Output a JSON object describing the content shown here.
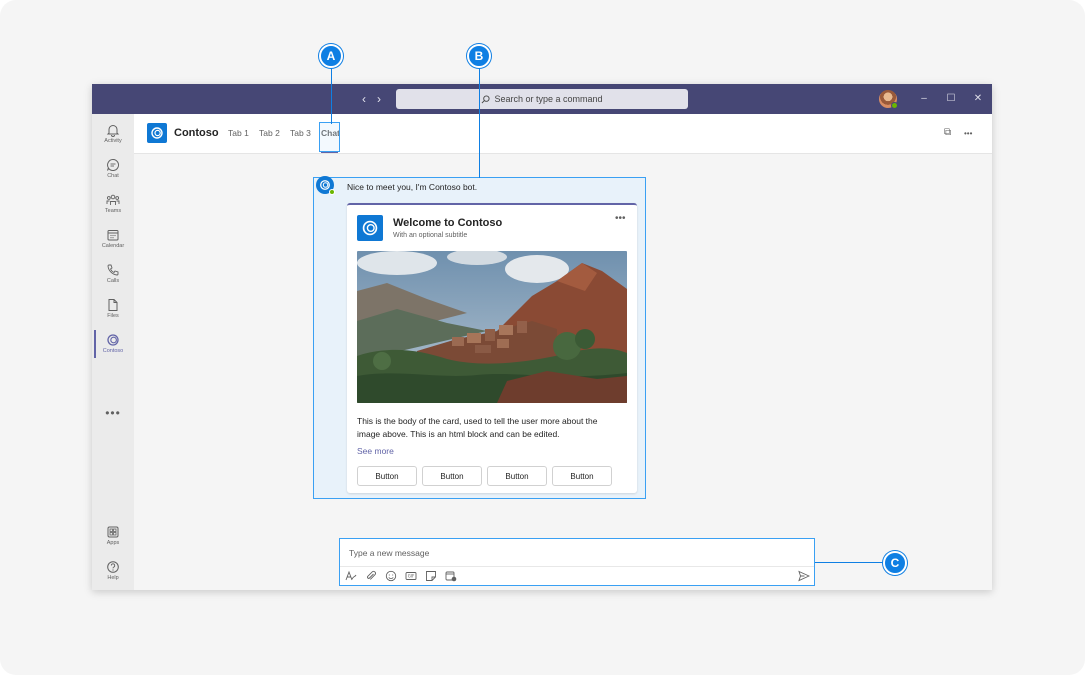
{
  "titlebar": {
    "search_placeholder": "Search or type a command",
    "back_label": "‹",
    "forward_label": "›",
    "minimize_label": "–",
    "maximize_label": "☐",
    "close_label": "✕"
  },
  "rail": {
    "items": [
      {
        "label": "Activity",
        "icon": "bell-icon"
      },
      {
        "label": "Chat",
        "icon": "chat-icon"
      },
      {
        "label": "Teams",
        "icon": "teams-icon"
      },
      {
        "label": "Calendar",
        "icon": "calendar-icon"
      },
      {
        "label": "Calls",
        "icon": "phone-icon"
      },
      {
        "label": "Files",
        "icon": "file-icon"
      },
      {
        "label": "Contoso",
        "icon": "contoso-icon"
      }
    ],
    "more_label": "•••",
    "bottom": [
      {
        "label": "Apps",
        "icon": "apps-icon"
      },
      {
        "label": "Help",
        "icon": "help-icon"
      }
    ]
  },
  "header": {
    "app_name": "Contoso",
    "tabs": [
      "Tab 1",
      "Tab 2",
      "Tab 3",
      "Chat"
    ],
    "active_tab": "Chat",
    "popout_label": "⧉",
    "more_label": "•••"
  },
  "chat": {
    "bot_message": "Nice to meet you, I'm Contoso bot.",
    "card": {
      "title": "Welcome to Contoso",
      "subtitle": "With an optional subtitle",
      "more_label": "•••",
      "body": "This is the body of the card, used to tell the user more about the image above. This is an html block and can be edited.",
      "see_more": "See more",
      "buttons": [
        "Button",
        "Button",
        "Button",
        "Button"
      ]
    }
  },
  "compose": {
    "placeholder": "Type a new message"
  },
  "callouts": {
    "a": "A",
    "b": "B",
    "c": "C"
  },
  "colors": {
    "titlebar": "#464775",
    "brand": "#6264a7",
    "callout": "#0f7fe3",
    "app_blue": "#0f78d4"
  }
}
